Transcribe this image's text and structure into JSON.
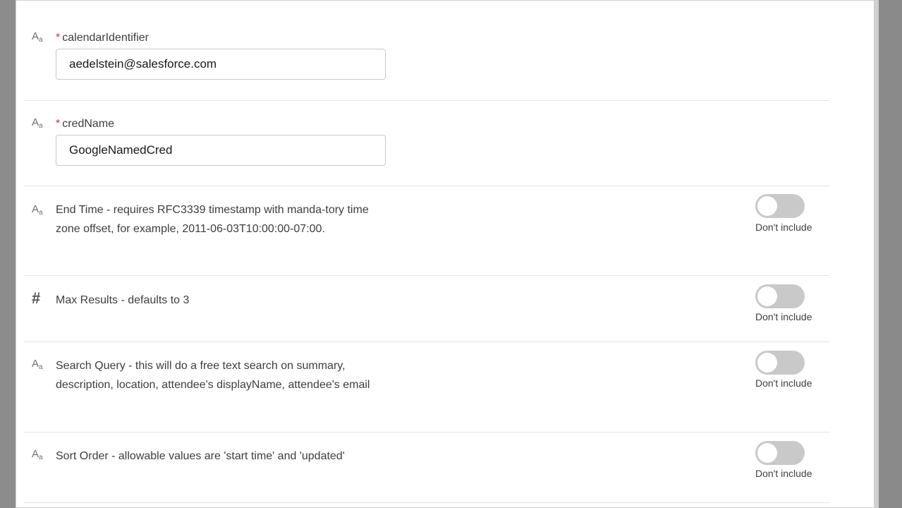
{
  "fields": {
    "calendar_identifier": {
      "required_mark": "*",
      "label": "calendarIdentifier",
      "value": "aedelstein@salesforce.com"
    },
    "cred_name": {
      "required_mark": "*",
      "label": "credName",
      "value": "GoogleNamedCred"
    }
  },
  "optional_fields": [
    {
      "type_icon": "text-type-icon",
      "description": "End Time - requires RFC3339 timestamp with manda-tory time zone offset, for example, 2011-06-03T10:00:00-07:00.",
      "toggle_label": "Don't include",
      "toggle_on": false
    },
    {
      "type_icon": "number-type-icon",
      "type_glyph": "#",
      "description": "Max Results - defaults to 3",
      "toggle_label": "Don't include",
      "toggle_on": false
    },
    {
      "type_icon": "text-type-icon",
      "description": "Search Query - this will do a free text search on summary, description, location, attendee's displayName, attendee's email",
      "toggle_label": "Don't include",
      "toggle_on": false
    },
    {
      "type_icon": "text-type-icon",
      "description": "Sort Order - allowable values are 'start time' and 'updated'",
      "toggle_label": "Don't include",
      "toggle_on": false
    }
  ],
  "colors": {
    "required": "#c23934",
    "toggle_off": "#c9c9c9",
    "panel": "#ffffff",
    "background": "#8a8a8a"
  }
}
